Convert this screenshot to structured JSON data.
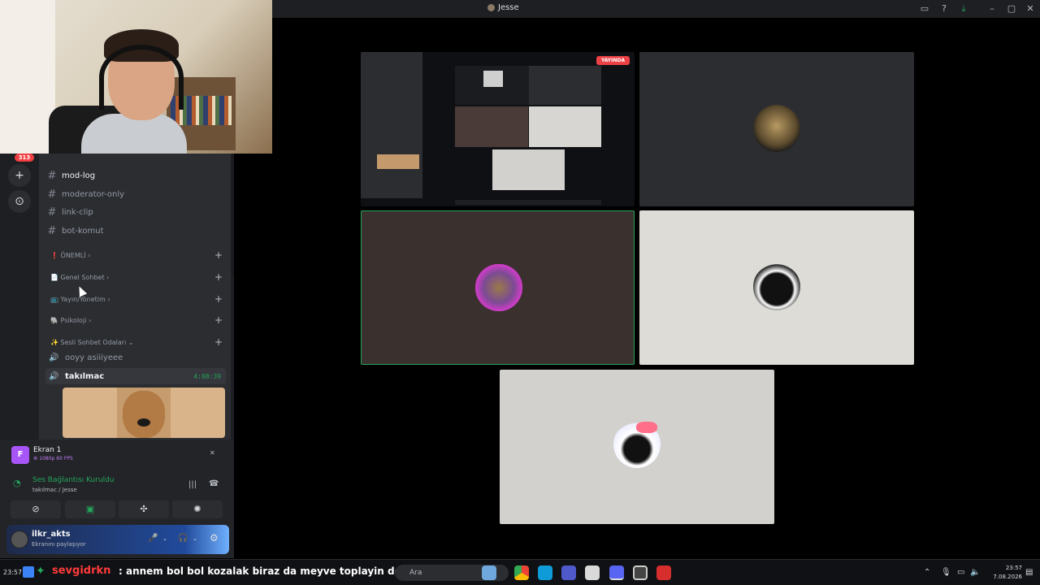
{
  "window": {
    "title": "Jesse"
  },
  "server_badge": "313",
  "channels": [
    {
      "name": "mod-log",
      "active": true
    },
    {
      "name": "moderator-only",
      "active": false
    },
    {
      "name": "link-clip",
      "active": false
    },
    {
      "name": "bot-komut",
      "active": false
    }
  ],
  "categories": [
    {
      "prefix": "❗",
      "label": "ÖNEMLİ"
    },
    {
      "prefix": "📄",
      "label": "Genel Sohbet"
    },
    {
      "prefix": "📺",
      "label": "Yayın/Yönetim"
    },
    {
      "prefix": "🐘",
      "label": "Psikoloji"
    },
    {
      "prefix": "✨",
      "label": "Sesli Sohbet Odaları"
    }
  ],
  "voice_channels": [
    {
      "name": "ooyy asiiiyeee",
      "live": false,
      "time": ""
    },
    {
      "name": "takılmac",
      "live": true,
      "time": "4:08:39"
    }
  ],
  "stream_panel": {
    "icon_letter": "F",
    "title": "Ekran 1",
    "quality": "⚙ 1080p 60 FPS"
  },
  "voice_panel": {
    "status": "Ses Bağlantısı Kuruldu",
    "location": "takılmac / Jesse"
  },
  "user": {
    "name": "ilkr_akts",
    "status": "Ekranını paylaşıyor"
  },
  "video_grid": {
    "live_badge": "YAYINDA"
  },
  "taskbar": {
    "time_left": "23:57",
    "chat_user": "sevgidrkn",
    "chat_message": ": annem bol bol kozalak biraz da meyve toplayin dedi",
    "search_placeholder": "Ara",
    "clock_time": "23:57",
    "clock_date": "7.08.2026"
  },
  "colors": {
    "accent_green": "#23a55a",
    "live_red": "#ed4245",
    "chat_user_red": "#ff3b3b",
    "badge_red": "#f23f43"
  }
}
